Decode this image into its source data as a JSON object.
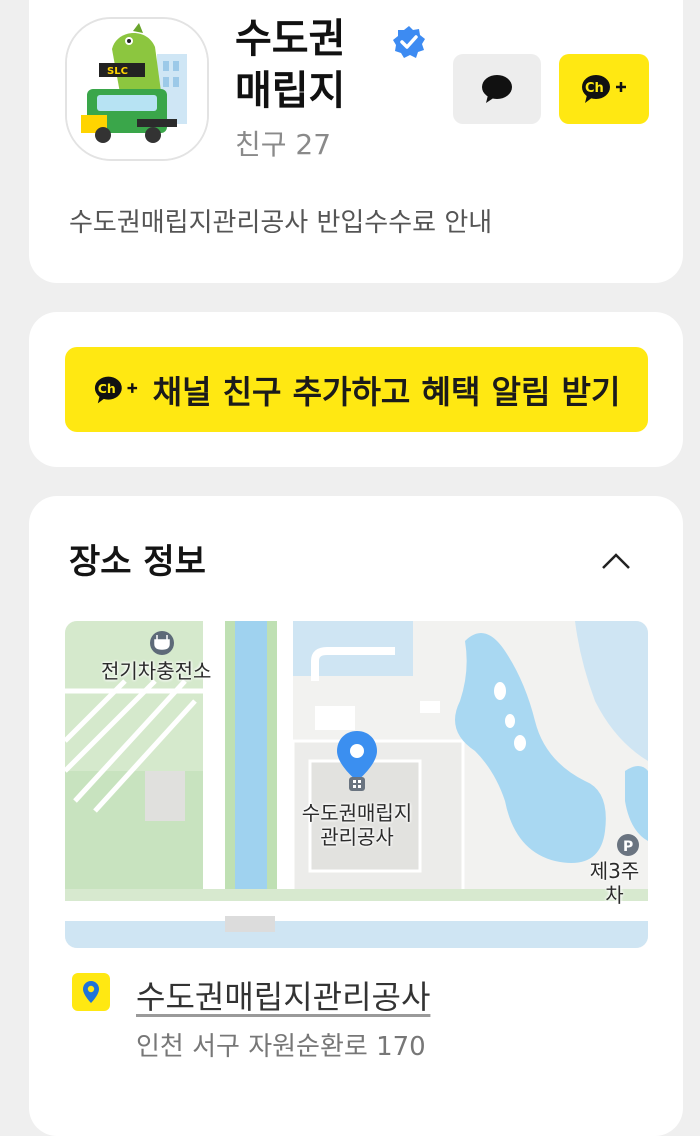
{
  "profile": {
    "name_line1": "수도권",
    "name_line2": "매립지",
    "friends": "친구 27",
    "description": "수도권매립지관리공사 반입수수료 안내",
    "avatar_sign": "SLC",
    "icons": {
      "chat": "chat-bubble-icon",
      "add": "channel-add-icon",
      "verified": "verified-badge-icon"
    }
  },
  "cta": {
    "label": "채널 친구 추가하고 혜택 알림 받기"
  },
  "place": {
    "section_title": "장소 정보",
    "map_labels": {
      "ev_charging": "전기차충전소",
      "building_line1": "수도권매립지",
      "building_line2": "관리공사",
      "parking": "제3주차"
    },
    "name": "수도권매립지관리공사",
    "address": "인천 서구 자원순환로 170"
  },
  "colors": {
    "brand_yellow": "#ffe812",
    "verified_blue": "#3d8bf2",
    "map_pin_blue": "#3b8ff0",
    "water": "#a9d8f2",
    "green_area": "#c8e3bf"
  }
}
